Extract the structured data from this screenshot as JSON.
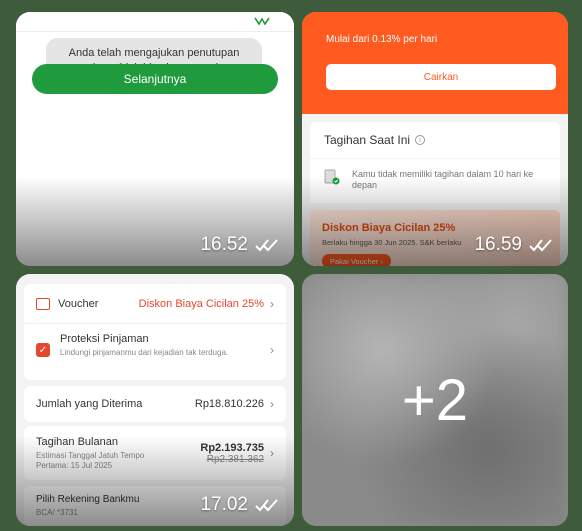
{
  "tile1": {
    "toast": "Anda telah mengajukan penutupan akun, tidak bisa beroperasi.",
    "button": "Selanjutnya",
    "time": "16.52"
  },
  "tile2": {
    "rate_text": "Mulai dari 0.13% per hari",
    "withdraw_button": "Cairkan",
    "bill_title": "Tagihan Saat Ini",
    "no_bill_text": "Kamu tidak memiliki tagihan dalam 10 hari ke depan",
    "promo_title": "Diskon Biaya Cicilan 25%",
    "promo_subtitle": "Berlaku hingga 30 Jun 2025. S&K berlaku",
    "promo_button": "Pakai Voucher",
    "time": "16.59"
  },
  "tile3": {
    "voucher_label": "Voucher",
    "voucher_value": "Diskon Biaya Cicilan 25%",
    "protection_title": "Proteksi Pinjaman",
    "protection_desc": "Lindungi pinjamanmu dari kejadian tak terduga.",
    "received_label": "Jumlah yang Diterima",
    "received_value": "Rp18.810.226",
    "monthly_label": "Tagihan Bulanan",
    "monthly_value": "Rp2.193.735",
    "monthly_old": "Rp2.381.362",
    "due_label": "Estimasi Tanggal Jatuh Tempo",
    "due_value": "Pertama: 15 Jul 2025",
    "bank_label": "Pilih Rekening Bankmu",
    "bank_value": "BCA/   *3731",
    "time": "17.02"
  },
  "tile4": {
    "more_count": "+2"
  },
  "colors": {
    "green": "#1f9a3d",
    "orange": "#ff5a1f",
    "red": "#e5482b"
  }
}
